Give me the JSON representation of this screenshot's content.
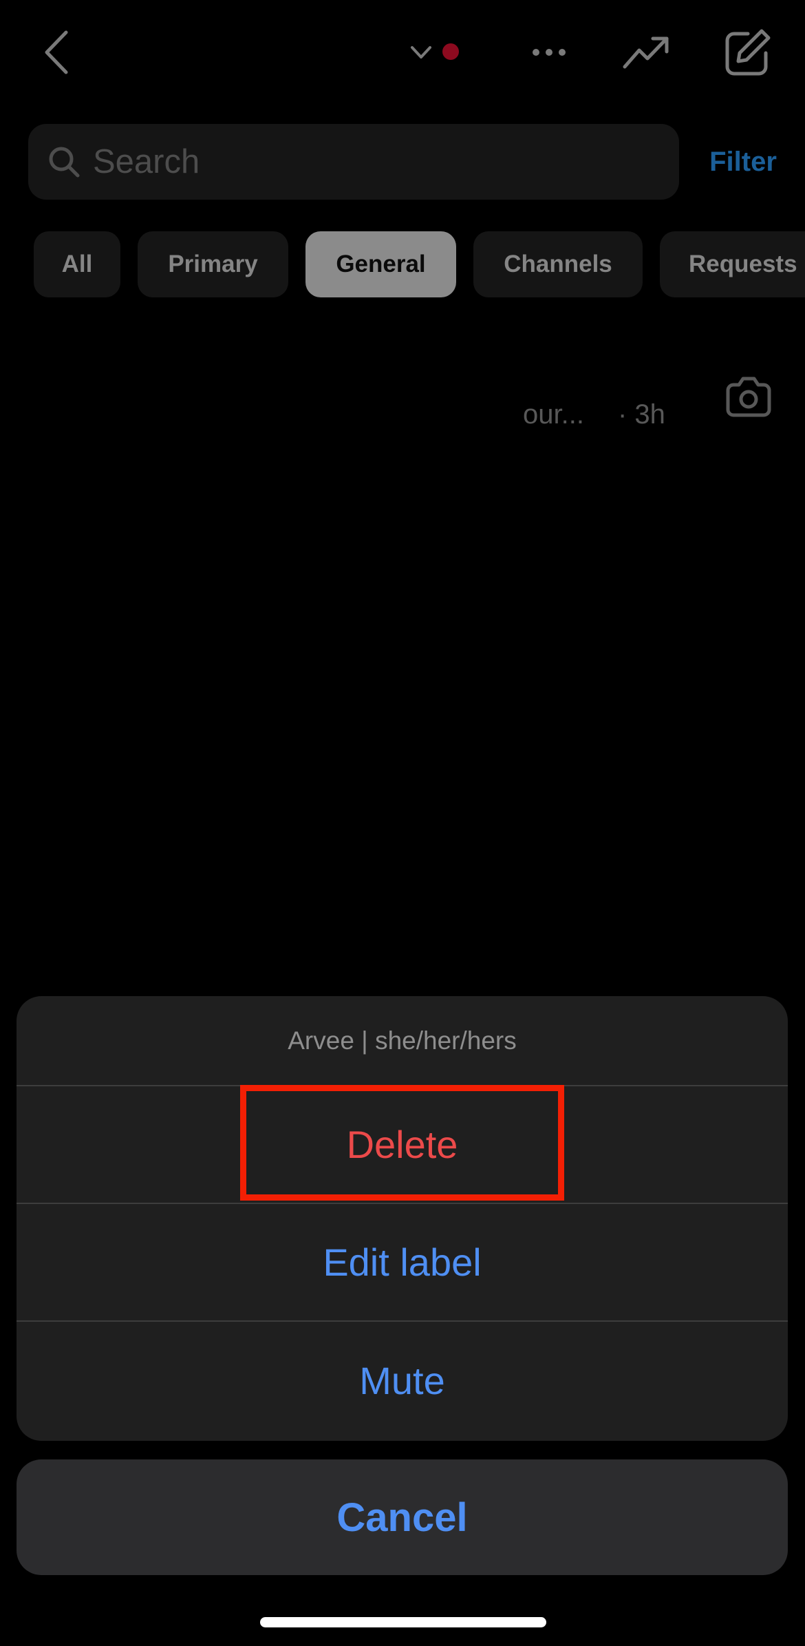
{
  "header": {
    "icons": {
      "back": "chevron-left-icon",
      "account_switch": "chevron-down-icon",
      "notification_dot_color": "#8d0a1f",
      "more": "more-horizontal-icon",
      "trending": "trending-up-icon",
      "compose": "compose-icon"
    }
  },
  "search": {
    "placeholder": "Search",
    "filter_label": "Filter"
  },
  "tabs": [
    {
      "label": "All",
      "active": false
    },
    {
      "label": "Primary",
      "active": false
    },
    {
      "label": "General",
      "active": true
    },
    {
      "label": "Channels",
      "active": false
    },
    {
      "label": "Requests",
      "active": false
    }
  ],
  "conversation": {
    "preview": "our...",
    "time": "· 3h",
    "camera_icon": "camera-icon"
  },
  "action_sheet": {
    "title": "Arvee | she/her/hers",
    "items": [
      {
        "label": "Delete",
        "style": "destructive"
      },
      {
        "label": "Edit label",
        "style": "default"
      },
      {
        "label": "Mute",
        "style": "default"
      }
    ],
    "cancel_label": "Cancel",
    "highlighted_item": "Delete",
    "highlight_color": "#f31f04"
  },
  "colors": {
    "accent_blue": "#4f8ff3",
    "destructive_red": "#ec4a4a",
    "filter_blue": "#1b5f99"
  }
}
